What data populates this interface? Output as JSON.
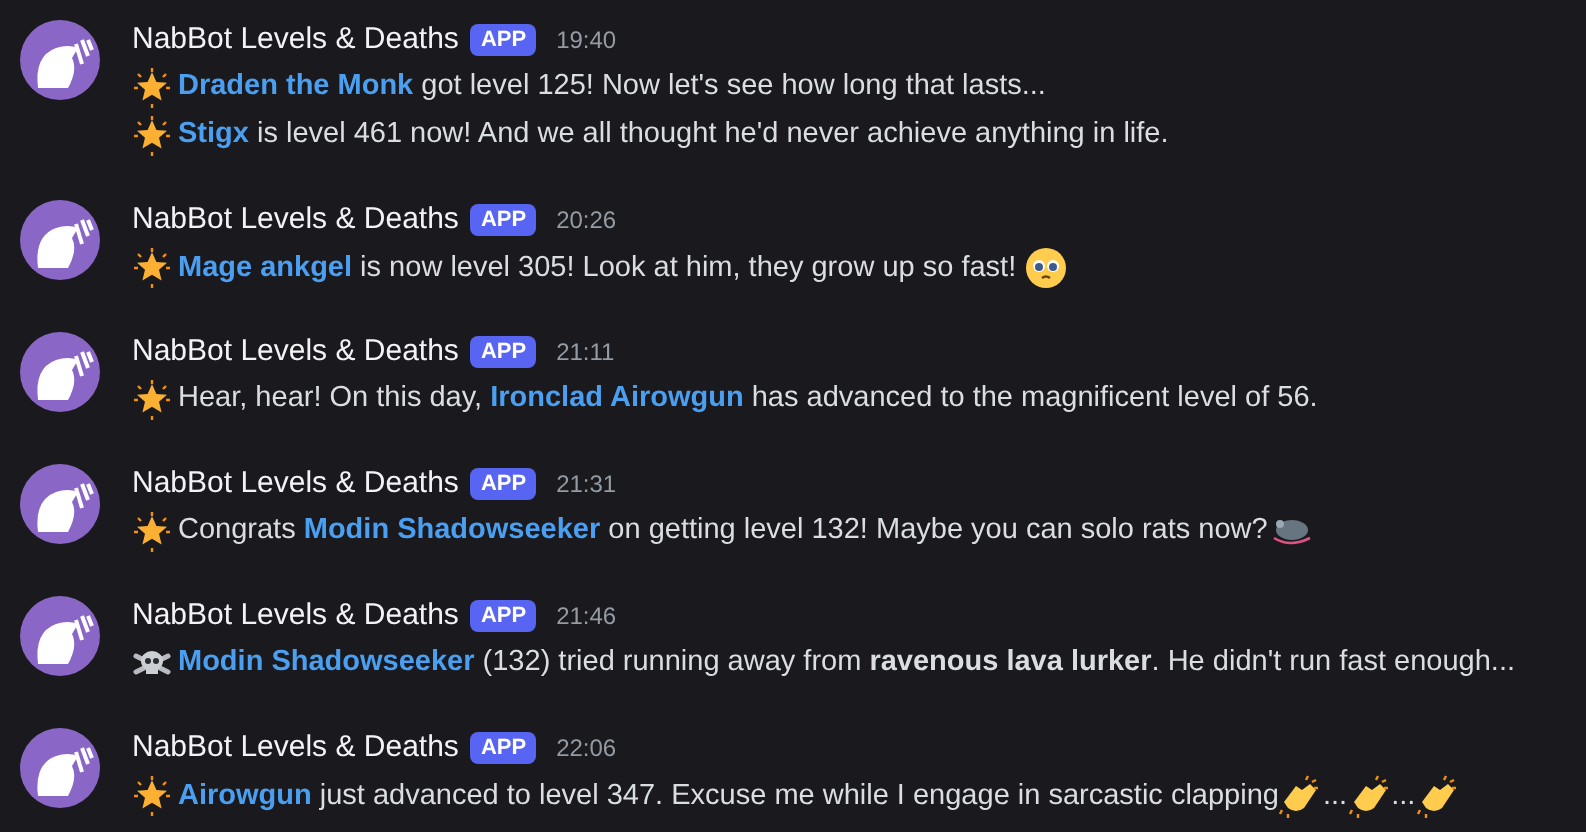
{
  "messages": [
    {
      "author": "NabBot Levels & Deaths",
      "badge": "APP",
      "time": "19:40",
      "lines": [
        {
          "kind": "level",
          "name": "Draden the Monk",
          "after": " got level 125! Now let's see how long that lasts..."
        },
        {
          "kind": "level",
          "name": "Stigx",
          "after": " is level 461 now! And we all thought he'd never achieve anything in life."
        }
      ]
    },
    {
      "author": "NabBot Levels & Deaths",
      "badge": "APP",
      "time": "20:26",
      "lines": [
        {
          "kind": "level",
          "name": "Mage ankgel",
          "after": " is now level 305! Look at him, they grow up so fast!",
          "trail": [
            {
              "kind": "pleading"
            }
          ]
        }
      ]
    },
    {
      "author": "NabBot Levels & Deaths",
      "badge": "APP",
      "time": "21:11",
      "lines": [
        {
          "kind": "level",
          "before": "Hear, hear! On this day, ",
          "name": "Ironclad Airowgun",
          "after": " has advanced to the magnificent level of 56."
        }
      ]
    },
    {
      "author": "NabBot Levels & Deaths",
      "badge": "APP",
      "time": "21:31",
      "lines": [
        {
          "kind": "level",
          "before": "Congrats ",
          "name": "Modin Shadowseeker",
          "after": " on getting level 132! Maybe you can solo rats now?",
          "trail": [
            {
              "kind": "rat"
            }
          ]
        }
      ]
    },
    {
      "author": "NabBot Levels & Deaths",
      "badge": "APP",
      "time": "21:46",
      "lines": [
        {
          "kind": "death",
          "name": "Modin Shadowseeker",
          "after": " (132) tried running away from **ravenous lava lurker**. He didn't run fast enough..."
        }
      ]
    },
    {
      "author": "NabBot Levels & Deaths",
      "badge": "APP",
      "time": "22:06",
      "lines": [
        {
          "kind": "level",
          "name": "Airowgun",
          "after": " just advanced to level 347. Excuse me while I engage in sarcastic clapping",
          "trail": [
            {
              "kind": "clap"
            },
            {
              "kind": "text",
              "text": "..."
            },
            {
              "kind": "clap"
            },
            {
              "kind": "text",
              "text": "..."
            },
            {
              "kind": "clap"
            }
          ]
        }
      ]
    }
  ]
}
